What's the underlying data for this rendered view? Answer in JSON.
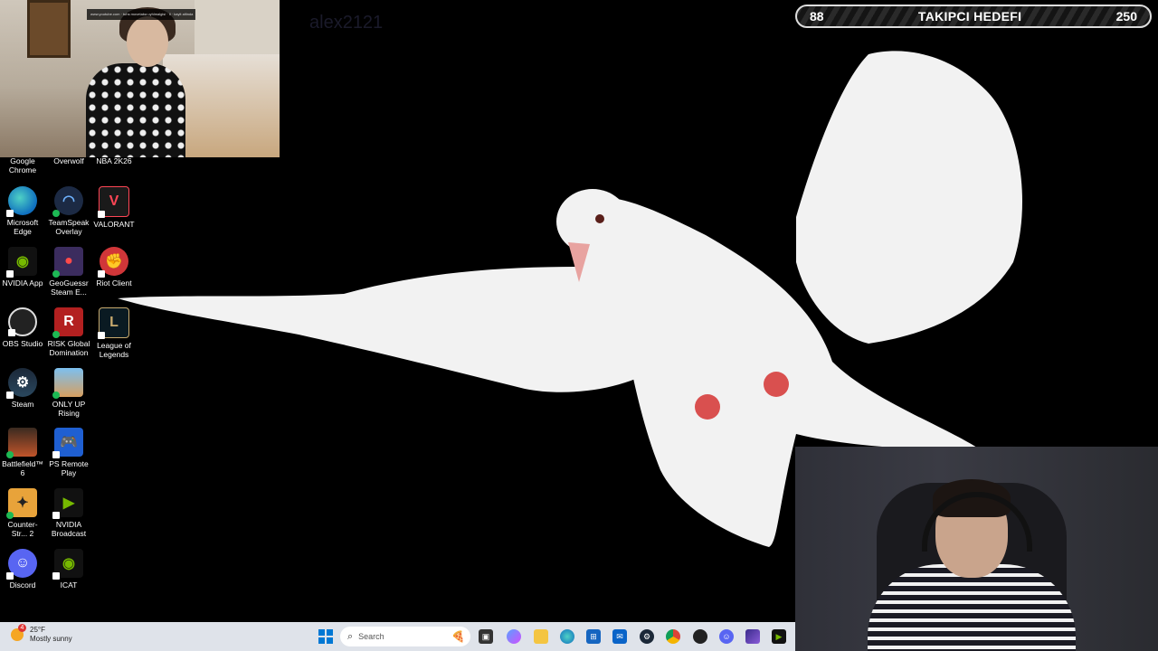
{
  "overlay": {
    "faint_text": "alex2121",
    "video_caption": "www.youtube.com · tuhs movetaba uyhlmalgisi · Il · kayit altinda"
  },
  "goal": {
    "current": "88",
    "title": "TAKIPCI HEDEFI",
    "target": "250",
    "progress": 0.35
  },
  "desktop": {
    "row0_labels": [
      "Google Chrome",
      "Overwolf",
      "NBA 2K26"
    ],
    "icons": [
      {
        "label": "Microsoft Edge"
      },
      {
        "label": "TeamSpeak Overlay"
      },
      {
        "label": "VALORANT"
      },
      {
        "label": "NVIDIA App"
      },
      {
        "label": "GeoGuessr Steam E..."
      },
      {
        "label": "Riot Client"
      },
      {
        "label": "OBS Studio"
      },
      {
        "label": "RISK Global Domination"
      },
      {
        "label": "League of Legends"
      },
      {
        "label": "Steam"
      },
      {
        "label": "ONLY UP Rising"
      },
      {
        "label": "Battlefield™ 6"
      },
      {
        "label": "PS Remote Play"
      },
      {
        "label": "Counter-Str... 2"
      },
      {
        "label": "NVIDIA Broadcast"
      },
      {
        "label": "Discord"
      },
      {
        "label": "ICAT"
      }
    ]
  },
  "taskbar": {
    "weather": {
      "badge": "4",
      "temp": "25°F",
      "condition": "Mostly sunny"
    },
    "search_placeholder": "Search",
    "pinned": [
      "start-icon",
      "search-icon",
      "task-view-icon",
      "copilot-icon",
      "file-explorer-icon",
      "edge-icon",
      "store-icon",
      "outlook-icon",
      "steam-icon",
      "chrome-icon",
      "obs-icon",
      "discord-icon",
      "app-icon",
      "nvidia-broadcast-icon"
    ]
  }
}
